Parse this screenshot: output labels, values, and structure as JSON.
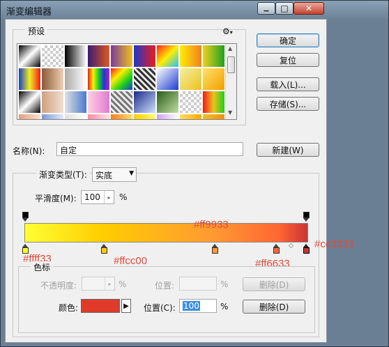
{
  "window": {
    "title": "渐变编辑器",
    "controls": {
      "minimize": "▁",
      "maximize": "□",
      "close": "✕"
    }
  },
  "buttons": {
    "ok": "确定",
    "reset": "复位",
    "load": "载入(L)...",
    "save": "存储(S)...",
    "new": "新建(W)",
    "delete_opacity": "删除(D)",
    "delete_color": "删除(D)"
  },
  "presets": {
    "label": "预设",
    "menu_icon": "gear-icon",
    "swatches": [
      "linear-gradient(135deg,#000,#fff,#000)",
      "repeating-conic-gradient(#ccc 0 25%, #fff 0 50%) 0 0/8px 8px",
      "linear-gradient(90deg,#000,#fff)",
      "linear-gradient(90deg,#3a1a7a,#e05a1a)",
      "linear-gradient(90deg,#7a3b9c,#f0c020)",
      "linear-gradient(90deg,#1a3ad0,#f01a1a)",
      "linear-gradient(135deg,#ff2020,#ffee00,#20c0ff)",
      "linear-gradient(90deg,#ffee00,#f08020)",
      "linear-gradient(90deg,#f0d020,#20a020)",
      "linear-gradient(90deg,#1a3ad0,#f0f020,#f01a1a)",
      "linear-gradient(90deg,#8a5a3a,#f0d0b0)",
      "linear-gradient(90deg,#aaa,#fff)",
      "linear-gradient(90deg,#f01a1a,#ffee00,#1ad01a,#1a3ad0,#c01ad0)",
      "linear-gradient(135deg,#f01a1a,#ffee00,#1ad01a,#1a3ad0)",
      "repeating-linear-gradient(45deg,#333 0 3px,#eee 3px 6px)",
      "linear-gradient(135deg,#fff,#1a3ad0)",
      "linear-gradient(135deg,#f0f0a0,#f0c020)",
      "linear-gradient(135deg,#ffe066,#f0a000)",
      "linear-gradient(135deg,#000,#fff,#000)",
      "linear-gradient(90deg,#d0a080,#f0e0d0)",
      "linear-gradient(90deg,#e0e0e0,#4a7ad0)",
      "linear-gradient(90deg,#ffd0e0,#e07ad0)",
      "repeating-linear-gradient(45deg,#777 0 3px,#eee 3px 6px)",
      "linear-gradient(135deg,#1a2a8a,#d0e0ff)",
      "linear-gradient(135deg,#2a5a1a,#c0e0a0)",
      "repeating-conic-gradient(#ccc 0 25%, #fff 0 50%) 0 0/8px 8px",
      "linear-gradient(90deg,#f01a1a,#f0c020,#1ad01a)",
      "linear-gradient(90deg,#e0a080,#ffe0d0)",
      "linear-gradient(90deg,#7a9ad0,#e0e8ff)",
      "linear-gradient(90deg,#e0e0e0,#ffffff)",
      "linear-gradient(90deg,#ff8aa0,#ffe0e8)",
      "linear-gradient(90deg,#ff7a20,#ffe066)",
      "linear-gradient(90deg,#ffcc00,#ffff66)",
      "linear-gradient(90deg,#d0a0f0,#ffffff)",
      "linear-gradient(90deg,#ffdd66,#ffaa00)",
      "linear-gradient(90deg,#f0c030,#f09010)"
    ]
  },
  "name": {
    "label": "名称(N):",
    "value": "自定"
  },
  "gradient_type": {
    "group_label": "渐变类型(T):",
    "value": "实底",
    "smoothness_label": "平滑度(M):",
    "smoothness_value": "100",
    "percent": "%"
  },
  "gradient_bar": {
    "colors": [
      "#ffff33",
      "#ffcc00",
      "#ff9933",
      "#ff6633",
      "#cc3333"
    ],
    "annotations": [
      {
        "text": "#ff9933"
      },
      {
        "text": "#cc3333"
      },
      {
        "text": "#ffff33"
      },
      {
        "text": "#ffcc00"
      },
      {
        "text": "#ff6633"
      }
    ]
  },
  "stops": {
    "group_label": "色标",
    "opacity_label": "不透明度:",
    "opacity_value": "",
    "opacity_percent": "%",
    "opacity_location_label": "位置:",
    "opacity_location_value": "",
    "opacity_location_percent": "%",
    "color_label": "颜色:",
    "color_value": "#e03a2a",
    "location_label": "位置(C):",
    "location_value": "100",
    "location_percent": "%"
  }
}
